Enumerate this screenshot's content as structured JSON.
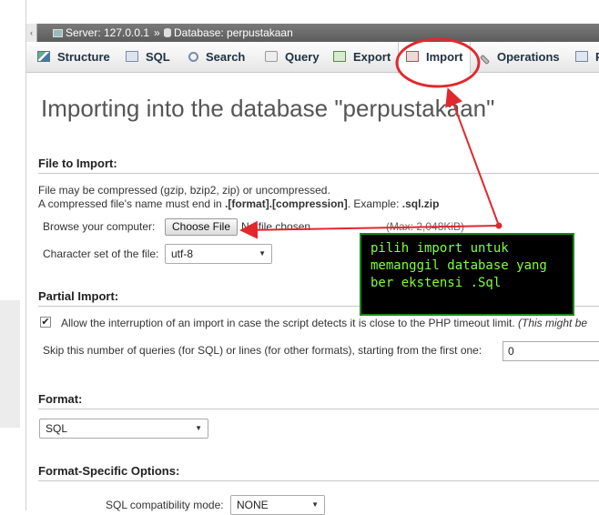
{
  "breadcrumb": {
    "server": "Server: 127.0.0.1",
    "separator": "»",
    "database": "Database: perpustakaan"
  },
  "tabs": [
    {
      "label": "Structure",
      "icon": "structure-icon"
    },
    {
      "label": "SQL",
      "icon": "sql-icon"
    },
    {
      "label": "Search",
      "icon": "search-icon"
    },
    {
      "label": "Query",
      "icon": "query-icon"
    },
    {
      "label": "Export",
      "icon": "export-icon"
    },
    {
      "label": "Import",
      "icon": "import-icon",
      "active": true
    },
    {
      "label": "Operations",
      "icon": "operations-icon"
    },
    {
      "label": "P",
      "icon": "privileges-icon"
    }
  ],
  "page_title": "Importing into the database \"perpustakaan\"",
  "file_to_import": {
    "heading": "File to Import:",
    "line1": "File may be compressed (gzip, bzip2, zip) or uncompressed.",
    "line2_pre": "A compressed file's name must end in ",
    "line2_bold": ".[format].[compression]",
    "line2_mid": ". Example: ",
    "line2_example": ".sql.zip",
    "browse_label": "Browse your computer:",
    "choose_file": "Choose File",
    "no_file": "No file chosen",
    "max_size": "(Max: 2,048KiB)",
    "charset_label": "Character set of the file:",
    "charset_value": "utf-8"
  },
  "partial_import": {
    "heading": "Partial Import:",
    "allow_interrupt_checked": true,
    "allow_interrupt_text": "Allow the interruption of an import in case the script detects it is close to the PHP timeout limit.",
    "allow_interrupt_note": "(This might be",
    "skip_label": "Skip this number of queries (for SQL) or lines (for other formats), starting from the first one:",
    "skip_value": "0"
  },
  "format": {
    "heading": "Format:",
    "value": "SQL"
  },
  "format_specific": {
    "heading": "Format-Specific Options:",
    "compat_label": "SQL compatibility mode:",
    "compat_value": "NONE"
  },
  "annotation": {
    "text": "pilih import untuk\nmemanggil database yang\nber ekstensi .Sql",
    "text_color": "#7fff3f",
    "border_color": "#1a8a1a",
    "arrow_color": "#e0282e"
  }
}
